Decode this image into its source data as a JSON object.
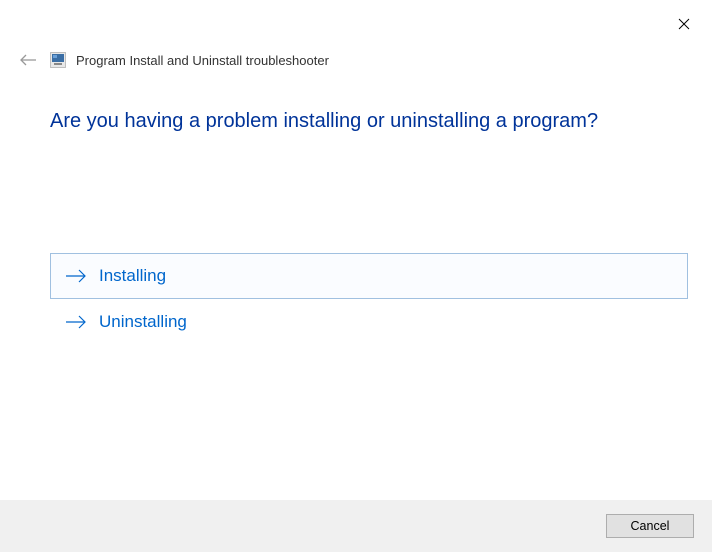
{
  "header": {
    "title": "Program Install and Uninstall troubleshooter"
  },
  "main": {
    "question": "Are you having a problem installing or uninstalling a program?",
    "options": [
      {
        "label": "Installing",
        "selected": true
      },
      {
        "label": "Uninstalling",
        "selected": false
      }
    ]
  },
  "footer": {
    "cancel_label": "Cancel"
  }
}
